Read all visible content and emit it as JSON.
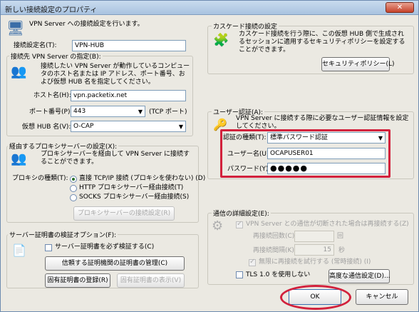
{
  "window": {
    "title": "新しい接続設定のプロパティ",
    "close": "✕"
  },
  "header": {
    "text": "VPN Server への接続設定を行います。"
  },
  "setting_name": {
    "label": "接続設定名(T):",
    "value": "VPN-HUB"
  },
  "dest": {
    "legend": "接続先 VPN Server の指定(B):",
    "desc": "接続したい VPN Server が動作しているコンピュータのホスト名または IP アドレス、ポート番号、および仮想 HUB 名を指定してください。",
    "host_label": "ホスト名(H):",
    "host_value": "vpn.packetix.net",
    "port_label": "ポート番号(P):",
    "port_value": "443",
    "port_suffix": "(TCP ポート)",
    "hub_label": "仮想 HUB 名(V):",
    "hub_value": "O-CAP"
  },
  "proxy": {
    "legend": "経由するプロキシサーバーの設定(X):",
    "desc": "プロキシサーバーを経由して VPN Server に接続することができます。",
    "type_label": "プロキシの種類(T):",
    "options": [
      "直接 TCP/IP 接続 (プロキシを使わない) (D)",
      "HTTP プロキシサーバー経由接続(T)",
      "SOCKS プロキシサーバー経由接続(S)"
    ],
    "settings_button": "プロキシサーバーの接続設定(R)"
  },
  "cert": {
    "legend": "サーバー証明書の検証オプション(F):",
    "check_label": "サーバー証明書を必ず検証する(C)",
    "trusted_button": "信頼する証明機関の証明書の管理(C)",
    "register_button": "固有証明書の登録(R)",
    "view_button": "固有証明書の表示(V)"
  },
  "cascade": {
    "legend": "カスケード接続の設定",
    "desc": "カスケード接続を行う際に、この仮想 HUB 側で生成されるセッションに適用するセキュリティポリシーを設定することができます。",
    "policy_button": "セキュリティポリシー(L)"
  },
  "auth": {
    "legend": "ユーザー認証(A):",
    "desc": "VPN Server に接続する際に必要なユーザー認証情報を設定してください。",
    "type_label": "認証の種類(T):",
    "type_value": "標準パスワード認証",
    "user_label": "ユーザー名(U):",
    "user_value": "OCAPUSER01",
    "password_label": "パスワード(Y):",
    "password_value": "●●●●●"
  },
  "advanced": {
    "legend": "通信の詳細設定(E):",
    "reconnect_label": "VPN Server との通信が切断された場合は再接続する(Z)",
    "retries_label": "再接続回数(C):",
    "retries_value": "",
    "interval_label": "再接続間隔(K):",
    "interval_value": "15",
    "interval_unit": "秒",
    "infinite_label": "無限に再接続を試行する (常時接続) (I)",
    "tls_label": "TLS 1.0 を使用しない",
    "advanced_button": "高度な通信設定(D)..."
  },
  "footer": {
    "ok": "OK",
    "cancel": "キャンセル"
  }
}
